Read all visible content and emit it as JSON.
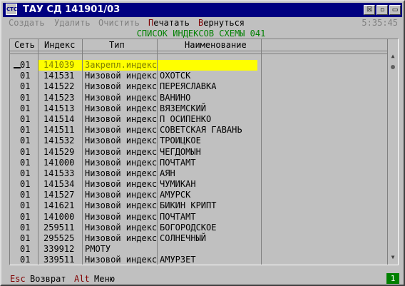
{
  "window": {
    "title": "ТАУ СД 141901/03",
    "app_icon_text": "CTC",
    "buttons": [
      "☒",
      "▫",
      "▭"
    ]
  },
  "menu": {
    "items": [
      {
        "label": "Создать",
        "state": "disabled"
      },
      {
        "label": "Удалить",
        "state": "disabled"
      },
      {
        "label": "Очистить",
        "state": "disabled"
      },
      {
        "hot": "П",
        "rest": "ечатать",
        "state": "active"
      },
      {
        "hot": "В",
        "rest": "ернуться",
        "state": "active"
      }
    ],
    "clock": "5:35:45"
  },
  "list": {
    "title": "СПИСОК ИНДЕКСОВ СХЕМЫ 041",
    "columns": [
      "Сеть",
      "Индекс",
      "Тип",
      "Наименование"
    ],
    "rows": [
      {
        "net": "01",
        "index": "141039",
        "type": "Закрепл.индекс",
        "name": "",
        "selected": true
      },
      {
        "net": "01",
        "index": "141531",
        "type": "Низовой индекс",
        "name": "ОХОТСК"
      },
      {
        "net": "01",
        "index": "141522",
        "type": "Низовой индекс",
        "name": "ПЕРЕЯСЛАВКА"
      },
      {
        "net": "01",
        "index": "141523",
        "type": "Низовой индекс",
        "name": "ВАНИНО"
      },
      {
        "net": "01",
        "index": "141513",
        "type": "Низовой индекс",
        "name": "ВЯЗЕМСКИЙ"
      },
      {
        "net": "01",
        "index": "141514",
        "type": "Низовой индекс",
        "name": "П ОСИПЕНКО"
      },
      {
        "net": "01",
        "index": "141511",
        "type": "Низовой индекс",
        "name": "СОВЕТСКАЯ ГАВАНЬ"
      },
      {
        "net": "01",
        "index": "141532",
        "type": "Низовой индекс",
        "name": "ТРОИЦКОЕ"
      },
      {
        "net": "01",
        "index": "141529",
        "type": "Низовой индекс",
        "name": "ЧЕГДОМЫН"
      },
      {
        "net": "01",
        "index": "141000",
        "type": "Низовой индекс",
        "name": "ПОЧТАМТ"
      },
      {
        "net": "01",
        "index": "141533",
        "type": "Низовой индекс",
        "name": "АЯН"
      },
      {
        "net": "01",
        "index": "141534",
        "type": "Низовой индекс",
        "name": "ЧУМИКАН"
      },
      {
        "net": "01",
        "index": "141527",
        "type": "Низовой индекс",
        "name": "АМУРСК"
      },
      {
        "net": "01",
        "index": "141621",
        "type": "Низовой индекс",
        "name": "БИКИН КРИПТ"
      },
      {
        "net": "01",
        "index": "141000",
        "type": "Низовой индекс",
        "name": "ПОЧТАМТ"
      },
      {
        "net": "01",
        "index": "259511",
        "type": "Низовой индекс",
        "name": "БОГОРОДСКОЕ"
      },
      {
        "net": "01",
        "index": "295525",
        "type": "Низовой индекс",
        "name": "СОЛНЕЧНЫЙ"
      },
      {
        "net": "01",
        "index": "339912",
        "type": "РМОТУ",
        "name": ""
      },
      {
        "net": "01",
        "index": "339511",
        "type": "Низовой индекс",
        "name": "АМУРЗЕТ"
      }
    ]
  },
  "status": {
    "esc_key": "Esc",
    "esc_label": "Возврат",
    "alt_key": "Alt",
    "alt_label": "Меню",
    "page_indicator": "1"
  },
  "colors": {
    "titlebar": "#000080",
    "selection": "#ffff00",
    "list_title": "#008000",
    "hotkey": "#800000",
    "page_indicator": "#008000"
  }
}
